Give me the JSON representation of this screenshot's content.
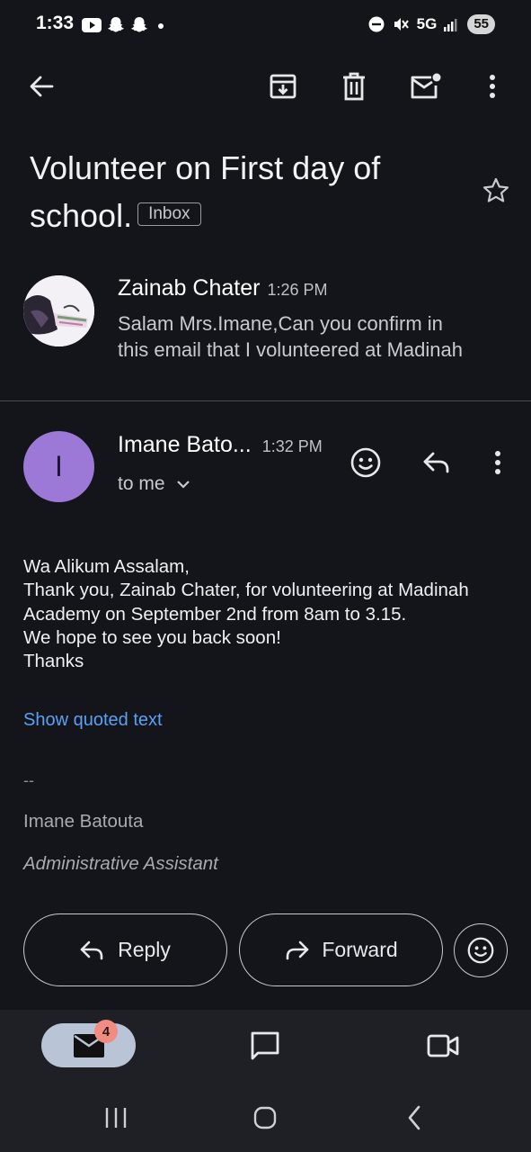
{
  "status_bar": {
    "time": "1:33",
    "network": "5G",
    "battery": "55",
    "left_icons": [
      "youtube-icon",
      "snapchat-icon",
      "snapchat-icon",
      "dot-icon"
    ],
    "right_icons": [
      "do-not-disturb-icon",
      "mute-icon",
      "signal-icon"
    ]
  },
  "toolbar": {
    "icons": [
      "back-arrow-icon",
      "archive-icon",
      "delete-icon",
      "mark-unread-icon",
      "more-vert-icon"
    ]
  },
  "subject": {
    "text": "Volunteer on First day of school.",
    "label": "Inbox"
  },
  "message1": {
    "sender": "Zainab Chater",
    "time": "1:26 PM",
    "snippet_line1": "Salam Mrs.Imane,Can you confirm in",
    "snippet_line2": "this email that I volunteered at Madinah"
  },
  "message2": {
    "avatar_letter": "I",
    "avatar_color": "#9c79d6",
    "sender": "Imane Bato...",
    "time": "1:32 PM",
    "recipient": "to me",
    "body": [
      "Wa Alikum Assalam,",
      "Thank you, Zainab Chater, for volunteering at Madinah",
      "Academy on September 2nd from 8am to 3.15.",
      "We hope to see you back soon!",
      "Thanks"
    ],
    "show_quoted": "Show quoted text",
    "sig_dash": "--",
    "sig_name": "Imane Batouta",
    "sig_title": "Administrative Assistant"
  },
  "actions": {
    "reply": "Reply",
    "forward": "Forward"
  },
  "bottom_nav": {
    "mail_badge": "4",
    "items": [
      "mail-icon",
      "chat-icon",
      "meet-icon"
    ]
  },
  "colors": {
    "background": "#14151a",
    "link": "#5aa0f7",
    "accent_pill": "#b9c5d6",
    "badge": "#f28b82"
  }
}
